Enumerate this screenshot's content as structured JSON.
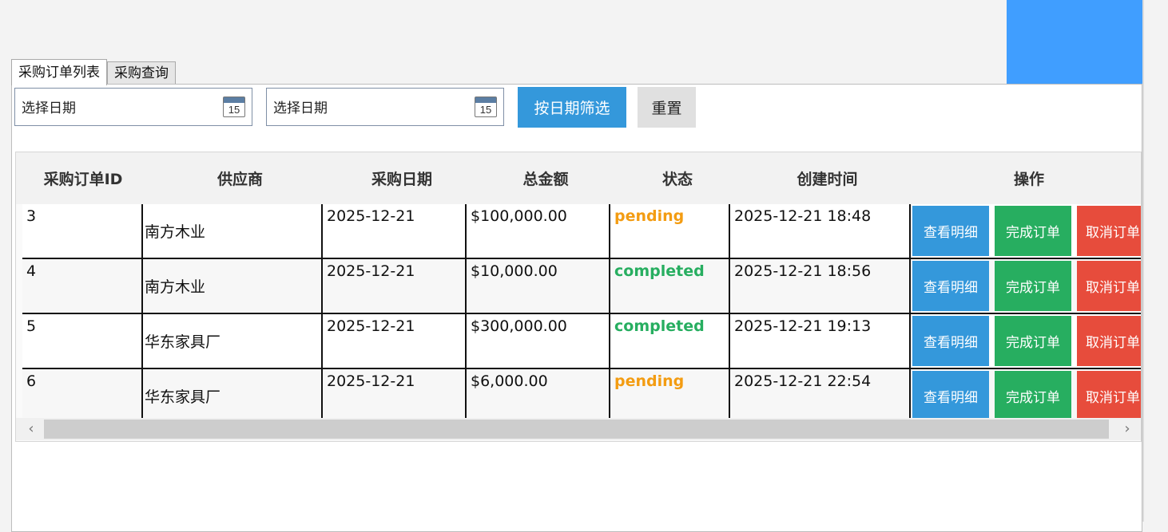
{
  "tabs": [
    {
      "label": "采购订单列表",
      "active": true
    },
    {
      "label": "采购查询",
      "active": false
    }
  ],
  "filters": {
    "start_date_placeholder": "选择日期",
    "end_date_placeholder": "选择日期",
    "calendar_day": "15",
    "filter_button": "按日期筛选",
    "reset_button": "重置"
  },
  "grid": {
    "headers": [
      "采购订单ID",
      "供应商",
      "采购日期",
      "总金额",
      "状态",
      "创建时间",
      "操作"
    ],
    "rows": [
      {
        "id": "3",
        "supplier": "南方木业",
        "date": "2025-12-21",
        "amount": "$100,000.00",
        "status": "pending",
        "created": "2025-12-21 18:48"
      },
      {
        "id": "4",
        "supplier": "南方木业",
        "date": "2025-12-21",
        "amount": "$10,000.00",
        "status": "completed",
        "created": "2025-12-21 18:56"
      },
      {
        "id": "5",
        "supplier": "华东家具厂",
        "date": "2025-12-21",
        "amount": "$300,000.00",
        "status": "completed",
        "created": "2025-12-21 19:13"
      },
      {
        "id": "6",
        "supplier": "华东家具厂",
        "date": "2025-12-21",
        "amount": "$6,000.00",
        "status": "pending",
        "created": "2025-12-21 22:54"
      }
    ],
    "actions": {
      "view": "查看明细",
      "complete": "完成订单",
      "cancel": "取消订单"
    },
    "scroll": {
      "left_arrow": "‹",
      "right_arrow": "›"
    }
  },
  "colors": {
    "accent_block": "#409eff",
    "view_button": "#3498db",
    "complete_button": "#27ae60",
    "cancel_button": "#e74c3c",
    "pending": "#f39c12",
    "completed": "#27ae60"
  }
}
